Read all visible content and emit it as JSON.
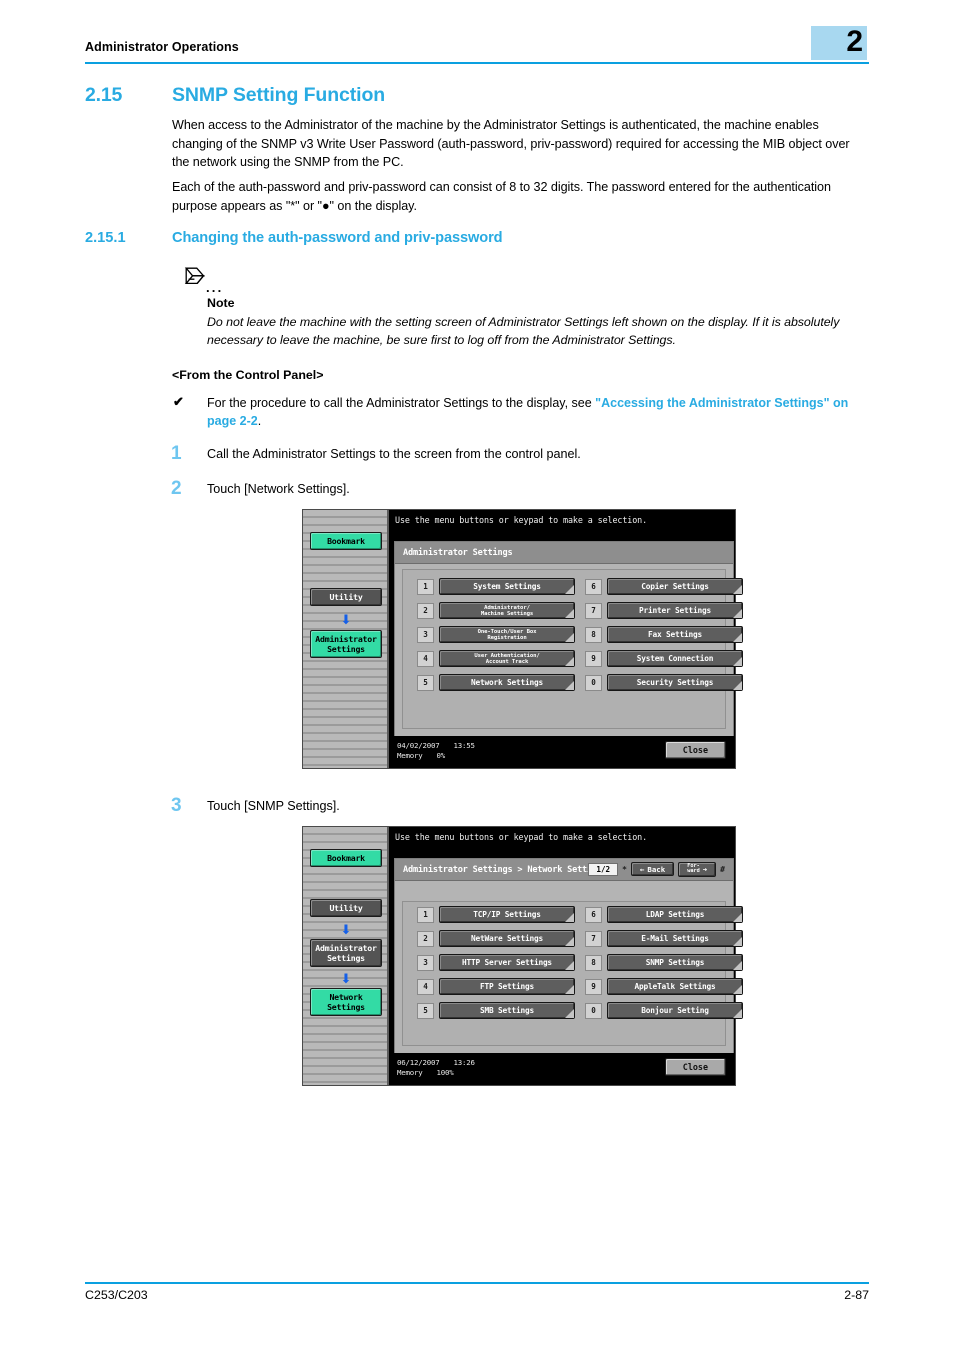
{
  "header": {
    "title": "Administrator Operations",
    "chapter": "2"
  },
  "section": {
    "number": "2.15",
    "title": "SNMP Setting Function",
    "paragraph1": "When access to the Administrator of the machine by the Administrator Settings is authenticated, the machine enables changing of the SNMP v3 Write User Password (auth-password, priv-password) required for accessing the MIB object over the network using the SNMP from the PC.",
    "paragraph2": "Each of the auth-password and priv-password can consist of 8 to 32 digits. The password entered for the authentication purpose appears as \"*\" or \"●\" on the display."
  },
  "subsection": {
    "number": "2.15.1",
    "title": "Changing the auth-password and priv-password"
  },
  "note": {
    "dots": "...",
    "label": "Note",
    "body": "Do not leave the machine with the setting screen of Administrator Settings left shown on the display. If it is absolutely necessary to leave the machine, be sure first to log off from the Administrator Settings."
  },
  "control_panel": {
    "heading": "<From the Control Panel>",
    "check_mark": "✔",
    "bullet_text_before": "For the procedure to call the Administrator Settings to the display, see ",
    "bullet_link": "\"Accessing the Administrator Settings\" on page 2-2",
    "bullet_text_after": "."
  },
  "steps": [
    {
      "number": "1",
      "text": "Call the Administrator Settings to the screen from the control panel."
    },
    {
      "number": "2",
      "text": "Touch [Network Settings]."
    },
    {
      "number": "3",
      "text": "Touch [SNMP Settings]."
    }
  ],
  "lcd1": {
    "top_message": "Use the menu buttons or keypad to make a selection.",
    "title": "Administrator Settings",
    "rail": [
      {
        "label": "Bookmark",
        "style": "green"
      },
      {
        "label": "Utility",
        "style": "dark"
      },
      {
        "label": "Administrator\nSettings",
        "style": "green"
      }
    ],
    "rail_labels": {
      "bookmark": "Bookmark",
      "utility": "Utility",
      "administrator_line1": "Administrator",
      "administrator_line2": "Settings"
    },
    "menu_left": [
      {
        "key": "1",
        "label": "System Settings"
      },
      {
        "key": "2",
        "label": "Administrator/",
        "label2": "Machine Settings"
      },
      {
        "key": "3",
        "label": "One-Touch/User Box",
        "label2": "Registration"
      },
      {
        "key": "4",
        "label": "User Authentication/",
        "label2": "Account Track"
      },
      {
        "key": "5",
        "label": "Network Settings"
      }
    ],
    "menu_right": [
      {
        "key": "6",
        "label": "Copier Settings"
      },
      {
        "key": "7",
        "label": "Printer Settings"
      },
      {
        "key": "8",
        "label": "Fax Settings"
      },
      {
        "key": "9",
        "label": "System Connection"
      },
      {
        "key": "0",
        "label": "Security Settings"
      }
    ],
    "status": {
      "date": "04/02/2007",
      "time": "13:55",
      "memory_label": "Memory",
      "memory_value": "0%"
    },
    "close_label": "Close"
  },
  "lcd2": {
    "top_message": "Use the menu buttons or keypad to make a selection.",
    "title": "Administrator Settings > Network Settings",
    "rail_labels": {
      "bookmark": "Bookmark",
      "utility": "Utility",
      "administrator_line1": "Administrator",
      "administrator_line2": "Settings",
      "network_line1": "Network",
      "network_line2": "Settings"
    },
    "pager": {
      "count": "1/2",
      "star": "*",
      "back_label": "Back",
      "back_arrow": "←",
      "forward_line1": "For-",
      "forward_line2": "ward",
      "forward_arrow": "➜",
      "hash": "#"
    },
    "menu_left": [
      {
        "key": "1",
        "label": "TCP/IP Settings"
      },
      {
        "key": "2",
        "label": "NetWare Settings"
      },
      {
        "key": "3",
        "label": "HTTP Server Settings"
      },
      {
        "key": "4",
        "label": "FTP Settings"
      },
      {
        "key": "5",
        "label": "SMB Settings"
      }
    ],
    "menu_right": [
      {
        "key": "6",
        "label": "LDAP Settings"
      },
      {
        "key": "7",
        "label": "E-Mail Settings"
      },
      {
        "key": "8",
        "label": "SNMP Settings"
      },
      {
        "key": "9",
        "label": "AppleTalk Settings"
      },
      {
        "key": "0",
        "label": "Bonjour Setting"
      }
    ],
    "status": {
      "date": "06/12/2007",
      "time": "13:26",
      "memory_label": "Memory",
      "memory_value": "100%"
    },
    "close_label": "Close"
  },
  "footer": {
    "left": "C253/C203",
    "right": "2-87"
  },
  "colors": {
    "accent_blue": "#29abe2",
    "rule_blue": "#0aa0e0",
    "badge_blue": "#a8d8f0",
    "lcd_green": "#33dba5"
  }
}
